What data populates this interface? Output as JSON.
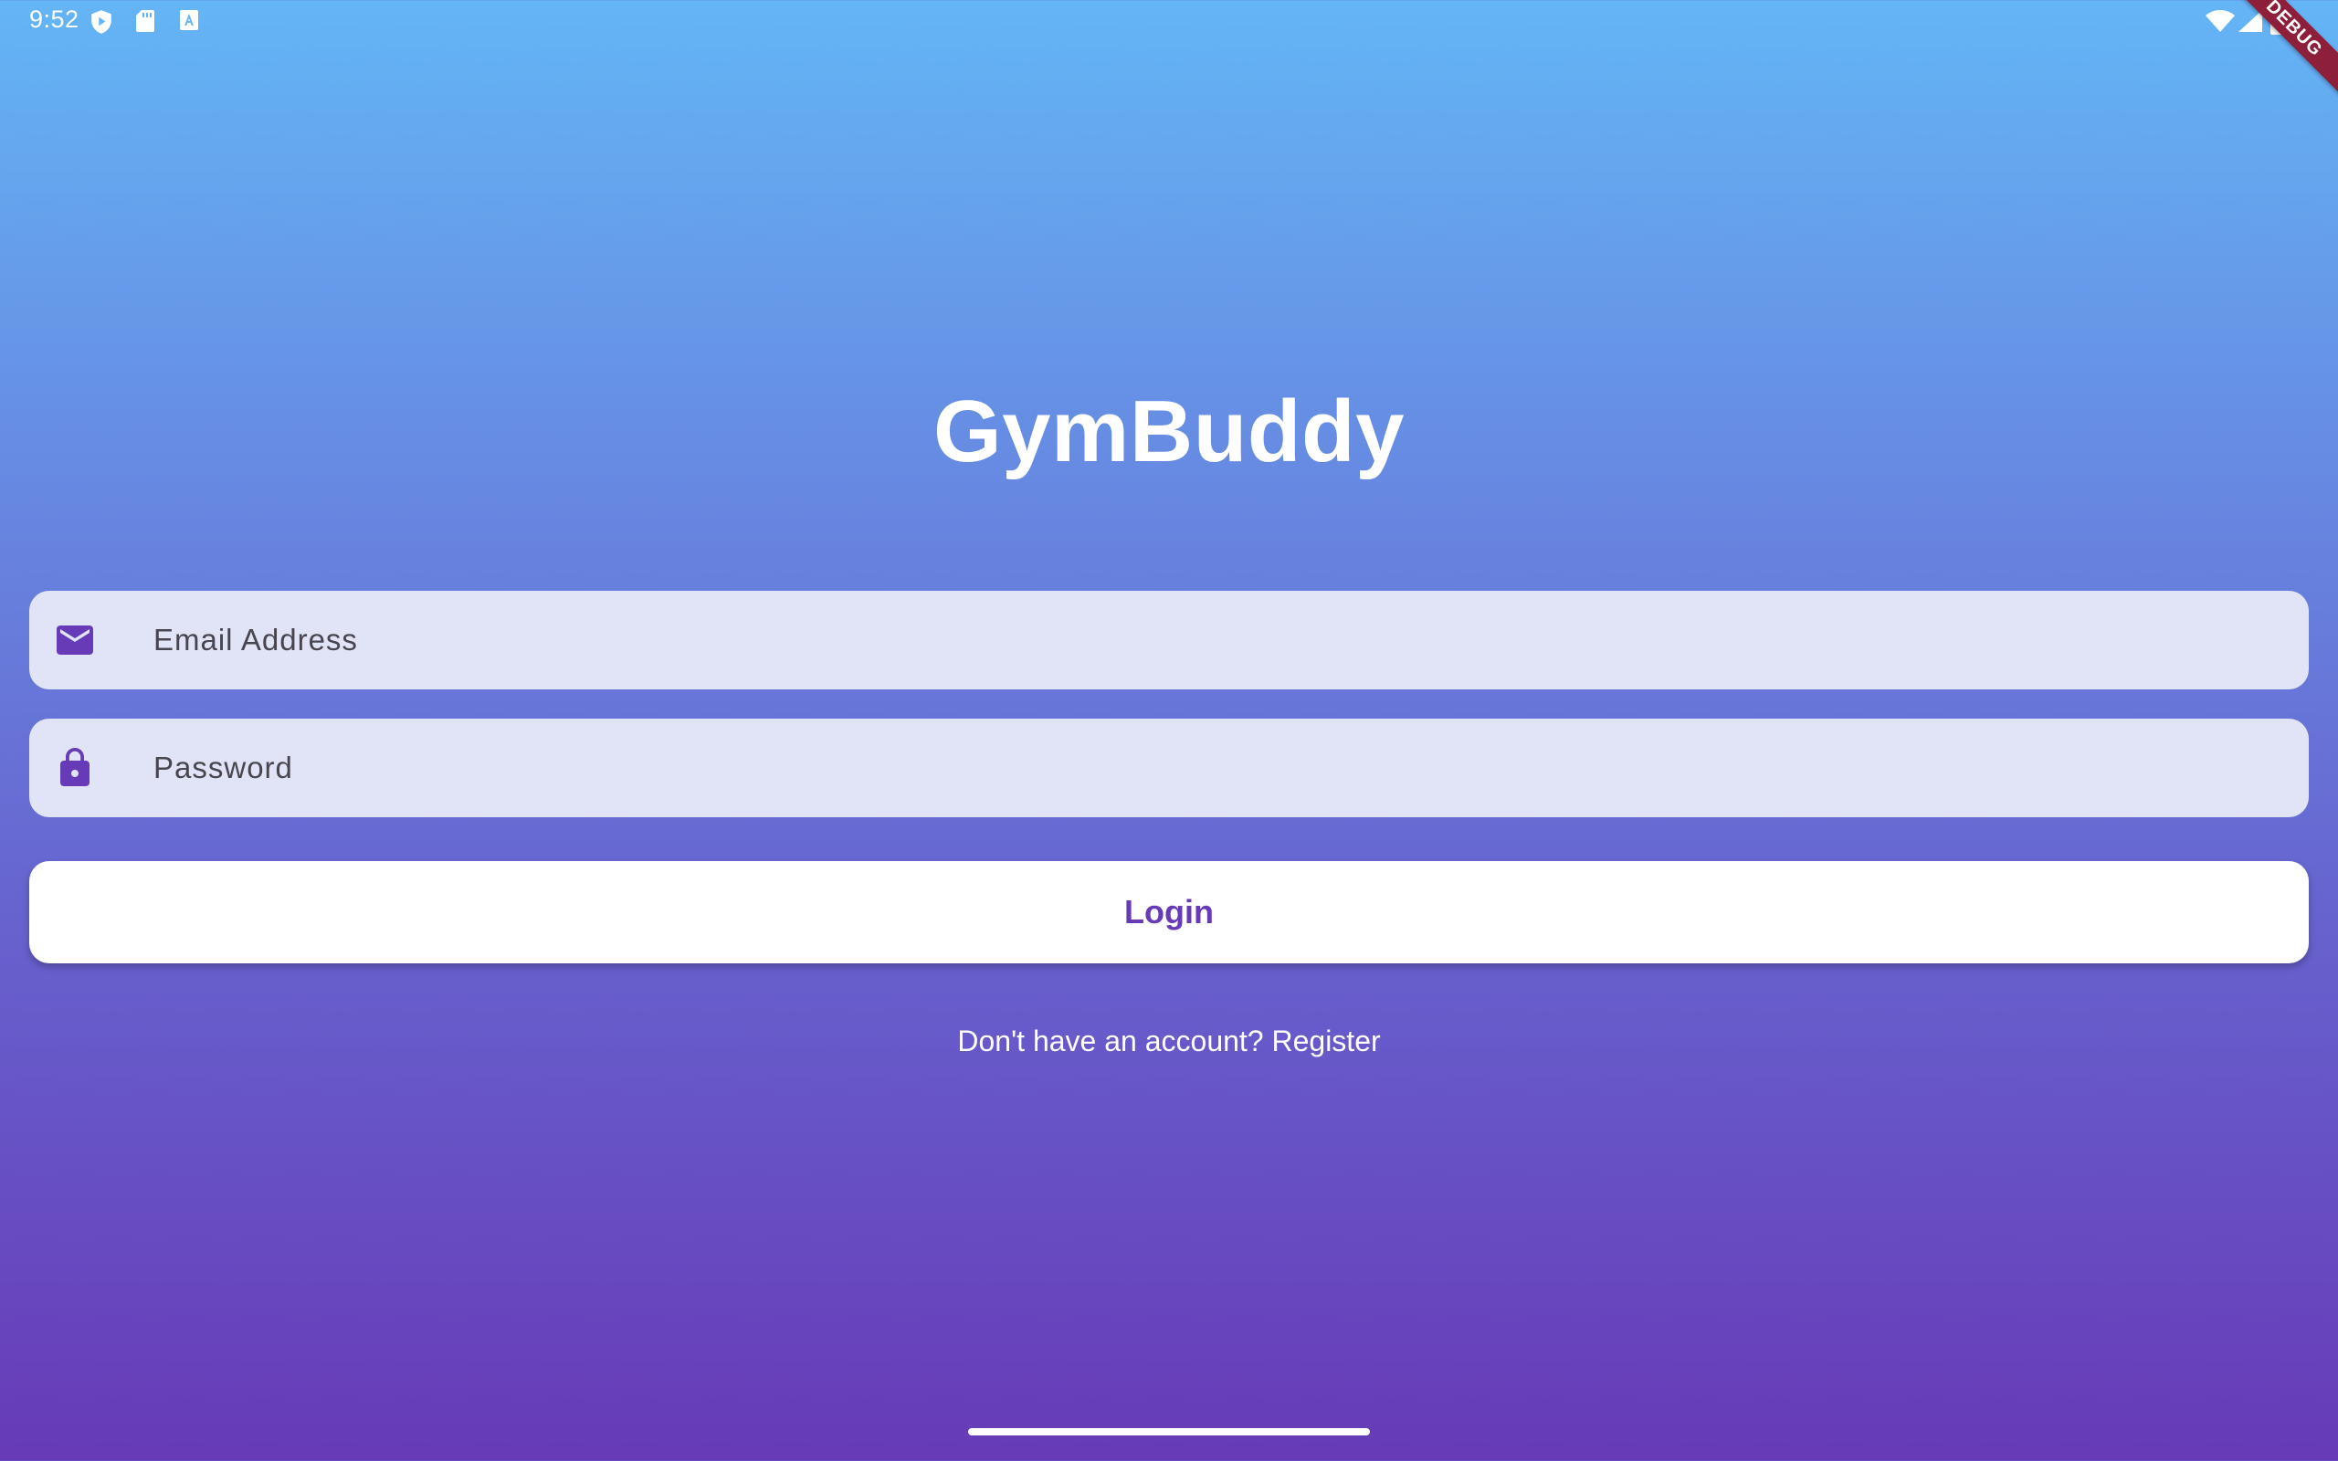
{
  "status_bar": {
    "time": "9:52",
    "left_icons": [
      "play-protect-icon",
      "sd-card-icon",
      "font-icon"
    ],
    "right_icons": [
      "wifi-icon",
      "signal-icon",
      "battery-icon"
    ]
  },
  "debug_banner": "DEBUG",
  "app": {
    "title": "GymBuddy"
  },
  "login_form": {
    "email": {
      "placeholder": "Email Address",
      "value": "",
      "icon": "email-icon"
    },
    "password": {
      "placeholder": "Password",
      "value": "",
      "icon": "lock-icon"
    },
    "login_label": "Login",
    "register_text": "Don't have an account? Register"
  },
  "colors": {
    "gradient_top": "#64B5F6",
    "gradient_bottom": "#673AB7",
    "accent": "#673AB7",
    "field_bg": "#E0E4F6"
  }
}
